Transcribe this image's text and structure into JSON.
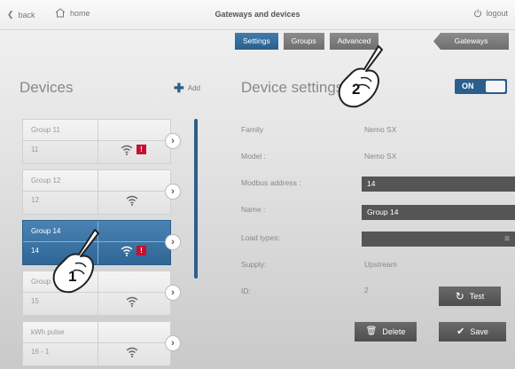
{
  "topbar": {
    "back_label": "back",
    "home_label": "home",
    "title": "Gateways and devices",
    "logout_label": "logout"
  },
  "tabs": [
    {
      "label": "Settings",
      "active": true
    },
    {
      "label": "Groups",
      "active": false
    },
    {
      "label": "Advanced",
      "active": false
    }
  ],
  "gateways_label": "Gateways",
  "devices": {
    "title": "Devices",
    "add_label": "Add",
    "items": [
      {
        "label": "Group 11",
        "sub": "11",
        "alert": true,
        "selected": false
      },
      {
        "label": "Group 12",
        "sub": "12",
        "alert": false,
        "selected": false
      },
      {
        "label": "Group 14",
        "sub": "14",
        "alert": true,
        "selected": true
      },
      {
        "label": "Group",
        "sub": "15",
        "alert": false,
        "selected": false
      },
      {
        "label": "kWh pulse",
        "sub": "16 - 1",
        "alert": false,
        "selected": false
      }
    ]
  },
  "settings": {
    "title": "Device settings",
    "toggle_label": "ON",
    "family_label": "Family",
    "family_value": "Nemo SX",
    "model_label": "Model :",
    "model_value": "Nemo SX",
    "modbus_label": "Modbus address :",
    "modbus_value": "14",
    "name_label": "Name :",
    "name_value": "Group 14",
    "load_label": "Load types:",
    "supply_label": "Supply:",
    "supply_value": "Upstream",
    "id_label": "ID:",
    "id_value": "2",
    "test_label": "Test",
    "delete_label": "Delete",
    "save_label": "Save"
  },
  "callouts": {
    "one": "1",
    "two": "2"
  },
  "colors": {
    "accent": "#2a5f8c",
    "alert": "#c4122f",
    "dark_field": "#555555"
  }
}
